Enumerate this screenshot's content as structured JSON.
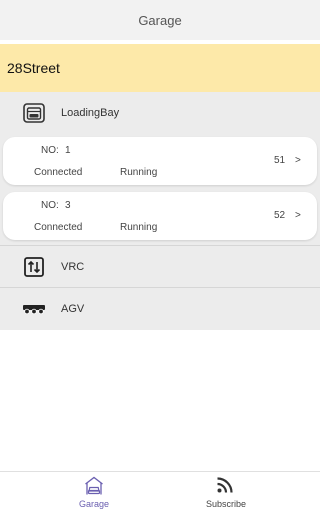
{
  "header": {
    "title": "Garage"
  },
  "site": {
    "name": "28Street"
  },
  "sections": {
    "loading_bay": {
      "label": "LoadingBay",
      "icon": "garage-icon"
    },
    "vrc": {
      "label": "VRC",
      "icon": "elevator-arrows-icon"
    },
    "agv": {
      "label": "AGV",
      "icon": "agv-vehicle-icon"
    }
  },
  "bays": [
    {
      "no_label": "NO:",
      "no_value": "1",
      "connection": "Connected",
      "status": "Running",
      "count": "51",
      "chevron": ">"
    },
    {
      "no_label": "NO:",
      "no_value": "3",
      "connection": "Connected",
      "status": "Running",
      "count": "52",
      "chevron": ">"
    }
  ],
  "tabbar": {
    "garage": {
      "label": "Garage",
      "icon": "car-garage-icon",
      "active": true,
      "color": "#6a5fb0"
    },
    "subscribe": {
      "label": "Subscribe",
      "icon": "rss-feed-icon",
      "active": false,
      "color": "#444444"
    }
  },
  "colors": {
    "site_bar": "#fde9a9",
    "list_bg": "#ececec",
    "header_bg": "#f2f2f2"
  }
}
